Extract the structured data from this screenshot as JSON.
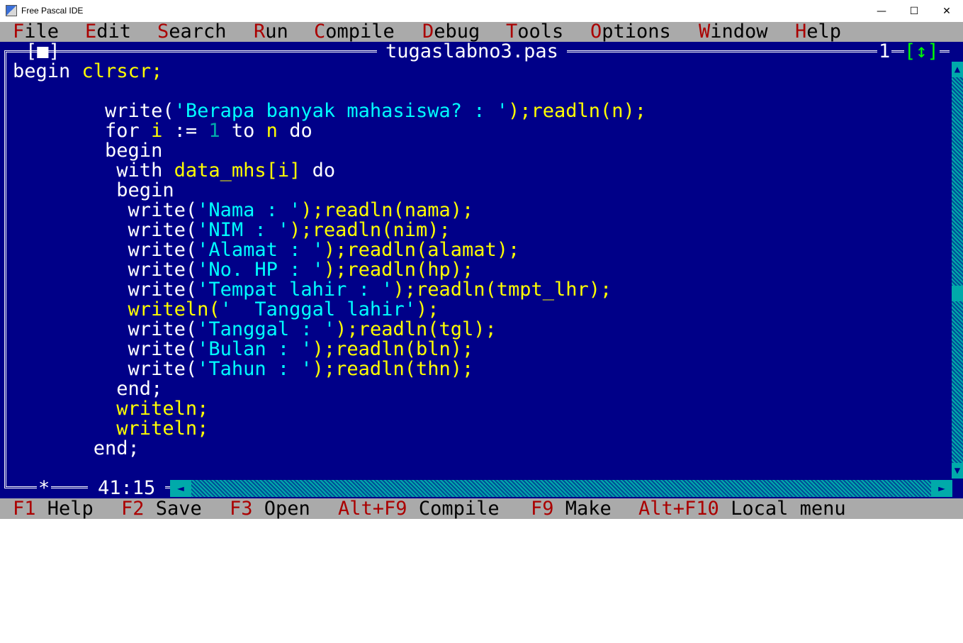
{
  "window": {
    "title": "Free Pascal IDE",
    "minimize": "—",
    "maximize": "☐",
    "close": "✕"
  },
  "menu": [
    {
      "hotkey": "F",
      "rest": "ile"
    },
    {
      "hotkey": "E",
      "rest": "dit"
    },
    {
      "hotkey": "S",
      "rest": "earch"
    },
    {
      "hotkey": "R",
      "rest": "un"
    },
    {
      "hotkey": "C",
      "rest": "ompile"
    },
    {
      "hotkey": "D",
      "rest": "ebug"
    },
    {
      "hotkey": "T",
      "rest": "ools"
    },
    {
      "hotkey": "O",
      "rest": "ptions"
    },
    {
      "hotkey": "W",
      "rest": "indow"
    },
    {
      "hotkey": "H",
      "rest": "elp"
    }
  ],
  "editor": {
    "filename": "tugaslabno3.pas",
    "window_number": "1",
    "close_box": "[■]",
    "zoom_box": "[↕]",
    "modified_marker": "*",
    "cursor_position": "41:15",
    "code_lines": [
      [
        {
          "t": "begin ",
          "c": "kw"
        },
        {
          "t": "clrscr;",
          "c": "id"
        }
      ],
      [],
      [
        {
          "t": "        write(",
          "c": "kw"
        },
        {
          "t": "'Berapa banyak mahasiswa? : '",
          "c": "str"
        },
        {
          "t": ");readln(n);",
          "c": "id"
        }
      ],
      [
        {
          "t": "        for ",
          "c": "kw"
        },
        {
          "t": "i",
          "c": "id"
        },
        {
          "t": " := ",
          "c": "kw"
        },
        {
          "t": "1",
          "c": "num"
        },
        {
          "t": " to ",
          "c": "kw"
        },
        {
          "t": "n",
          "c": "id"
        },
        {
          "t": " do",
          "c": "kw"
        }
      ],
      [
        {
          "t": "        begin",
          "c": "kw"
        }
      ],
      [
        {
          "t": "         with ",
          "c": "kw"
        },
        {
          "t": "data_mhs[i]",
          "c": "id"
        },
        {
          "t": " do",
          "c": "kw"
        }
      ],
      [
        {
          "t": "         begin",
          "c": "kw"
        }
      ],
      [
        {
          "t": "          write(",
          "c": "kw"
        },
        {
          "t": "'Nama : '",
          "c": "str"
        },
        {
          "t": ");readln(nama);",
          "c": "id"
        }
      ],
      [
        {
          "t": "          write(",
          "c": "kw"
        },
        {
          "t": "'NIM : '",
          "c": "str"
        },
        {
          "t": ");readln(nim);",
          "c": "id"
        }
      ],
      [
        {
          "t": "          write(",
          "c": "kw"
        },
        {
          "t": "'Alamat : '",
          "c": "str"
        },
        {
          "t": ");readln(alamat);",
          "c": "id"
        }
      ],
      [
        {
          "t": "          write(",
          "c": "kw"
        },
        {
          "t": "'No. HP : '",
          "c": "str"
        },
        {
          "t": ");readln(hp);",
          "c": "id"
        }
      ],
      [
        {
          "t": "          write(",
          "c": "kw"
        },
        {
          "t": "'Tempat lahir : '",
          "c": "str"
        },
        {
          "t": ");readln(tmpt_lhr);",
          "c": "id"
        }
      ],
      [
        {
          "t": "          writeln(",
          "c": "id"
        },
        {
          "t": "'  Tanggal lahir'",
          "c": "str"
        },
        {
          "t": ");",
          "c": "id"
        }
      ],
      [
        {
          "t": "          write(",
          "c": "kw"
        },
        {
          "t": "'Tanggal : '",
          "c": "str"
        },
        {
          "t": ");readln(tgl);",
          "c": "id"
        }
      ],
      [
        {
          "t": "          write(",
          "c": "kw"
        },
        {
          "t": "'Bulan : '",
          "c": "str"
        },
        {
          "t": ");readln(bln);",
          "c": "id"
        }
      ],
      [
        {
          "t": "          write(",
          "c": "kw"
        },
        {
          "t": "'Tahun : '",
          "c": "str"
        },
        {
          "t": ");readln(thn);",
          "c": "id"
        }
      ],
      [
        {
          "t": "         end;",
          "c": "kw"
        }
      ],
      [
        {
          "t": "         writeln;",
          "c": "id"
        }
      ],
      [
        {
          "t": "         writeln;",
          "c": "id"
        }
      ],
      [
        {
          "t": "       end;",
          "c": "kw"
        }
      ]
    ]
  },
  "statusbar": [
    {
      "key": "F1",
      "label": "Help"
    },
    {
      "key": "F2",
      "label": "Save"
    },
    {
      "key": "F3",
      "label": "Open"
    },
    {
      "key": "Alt+F9",
      "label": "Compile"
    },
    {
      "key": "F9",
      "label": "Make"
    },
    {
      "key": "Alt+F10",
      "label": "Local menu"
    }
  ],
  "colors": {
    "editor_bg": "#000088",
    "menu_bg": "#aaaaaa",
    "hotkey": "#aa0000",
    "identifier": "#ffff00",
    "string": "#00ffff",
    "keyword": "#ffffff",
    "number": "#00aaaa"
  }
}
